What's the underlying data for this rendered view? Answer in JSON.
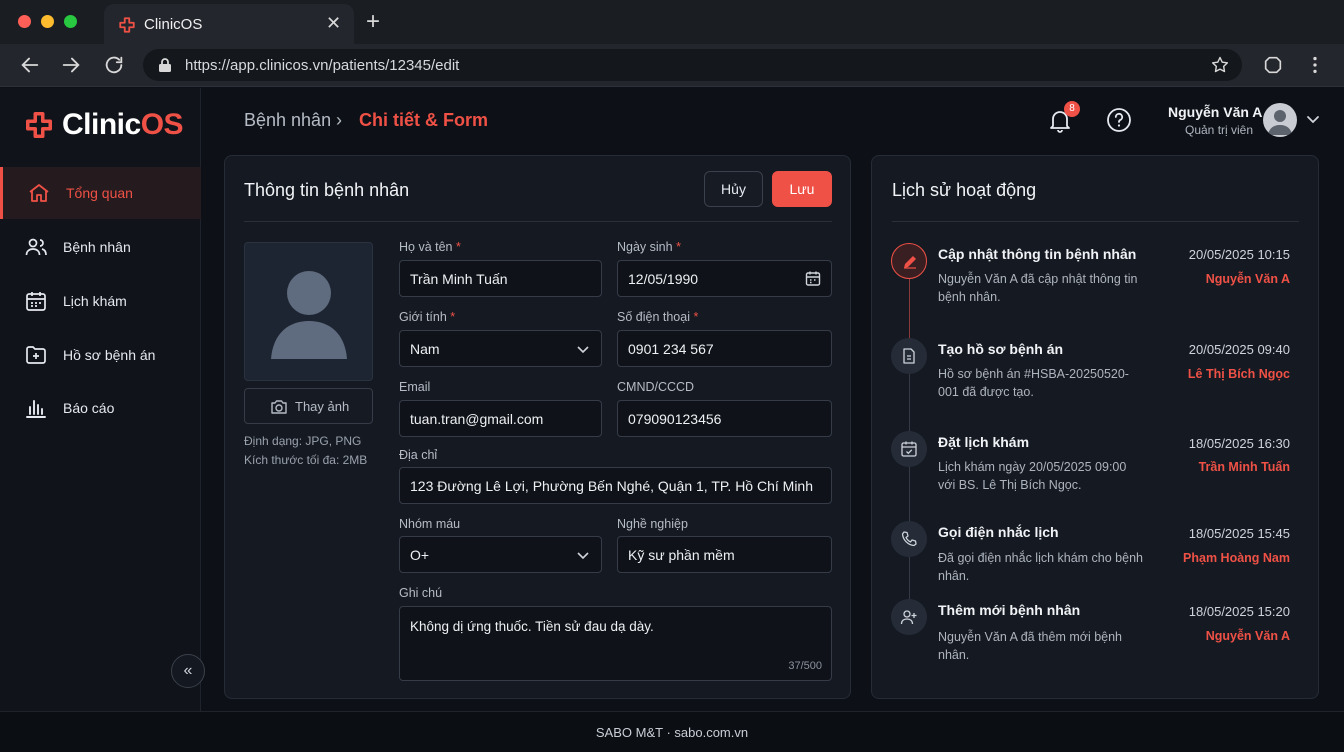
{
  "browser": {
    "tab_title": "ClinicOS",
    "url": "https://app.clinicos.vn/patients/12345/edit"
  },
  "brand": {
    "name_part1": "Clinic",
    "name_part2": "OS",
    "accent": "#ef5146"
  },
  "sidebar": {
    "items": [
      {
        "label": "Tổng quan",
        "icon": "home-icon",
        "active": true
      },
      {
        "label": "Bệnh nhân",
        "icon": "users-icon"
      },
      {
        "label": "Lịch khám",
        "icon": "calendar-icon"
      },
      {
        "label": "Hồ sơ bệnh án",
        "icon": "medical-folder-icon"
      },
      {
        "label": "Báo cáo",
        "icon": "bar-chart-icon"
      }
    ]
  },
  "header": {
    "breadcrumb_root": "Bệnh nhân",
    "breadcrumb_sep": "›",
    "breadcrumb_current": "Chi tiết & Form",
    "notification_count": "8",
    "user_name": "Nguyễn Văn A",
    "user_role": "Quản trị viên"
  },
  "patient_form": {
    "title": "Thông tin bệnh nhân",
    "cancel_label": "Hủy",
    "save_label": "Lưu",
    "change_photo_label": "Thay ảnh",
    "format_hint": "Định dạng: JPG, PNG",
    "size_hint": "Kích thước tối đa: 2MB",
    "fields": {
      "full_name": {
        "label": "Họ và tên",
        "required": "*",
        "value": "Trần Minh Tuấn"
      },
      "dob": {
        "label": "Ngày sinh",
        "required": "*",
        "value": "12/05/1990"
      },
      "gender": {
        "label": "Giới tính",
        "required": "*",
        "value": "Nam"
      },
      "phone": {
        "label": "Số điện thoại",
        "required": "*",
        "value": "0901 234 567"
      },
      "email": {
        "label": "Email",
        "value": "tuan.tran@gmail.com"
      },
      "id_card": {
        "label": "CMND/CCCD",
        "value": "079090123456"
      },
      "address": {
        "label": "Địa chỉ",
        "value": "123 Đường Lê Lợi, Phường Bến Nghé, Quận 1, TP. Hồ Chí Minh"
      },
      "blood_type": {
        "label": "Nhóm máu",
        "value": "O+"
      },
      "occupation": {
        "label": "Nghề nghiệp",
        "value": "Kỹ sư phần mềm"
      },
      "notes": {
        "label": "Ghi chú",
        "value": "Không dị ứng thuốc. Tiền sử đau dạ dày.",
        "counter": "37/500"
      }
    }
  },
  "activity": {
    "title": "Lịch sử hoạt động",
    "items": [
      {
        "title": "Cập nhật thông tin bệnh nhân",
        "desc": "Nguyễn Văn A đã cập nhật thông tin bệnh nhân.",
        "time": "20/05/2025 10:15",
        "user": "Nguyễn Văn A",
        "icon": "pencil-icon"
      },
      {
        "title": "Tạo hồ sơ bệnh án",
        "desc": "Hồ sơ bệnh án #HSBA-20250520-001 đã được tạo.",
        "time": "20/05/2025 09:40",
        "user": "Lê Thị Bích Ngọc",
        "icon": "document-icon"
      },
      {
        "title": "Đặt lịch khám",
        "desc": "Lịch khám ngày 20/05/2025 09:00 với BS. Lê Thị Bích Ngọc.",
        "time": "18/05/2025 16:30",
        "user": "Trần Minh Tuấn",
        "icon": "calendar-check-icon"
      },
      {
        "title": "Gọi điện nhắc lịch",
        "desc": "Đã gọi điện nhắc lịch khám cho bệnh nhân.",
        "time": "18/05/2025 15:45",
        "user": "Phạm Hoàng Nam",
        "icon": "phone-icon"
      },
      {
        "title": "Thêm mới bệnh nhân",
        "desc": "Nguyễn Văn A đã thêm mới bệnh nhân.",
        "time": "18/05/2025 15:20",
        "user": "Nguyễn Văn A",
        "icon": "user-plus-icon"
      }
    ]
  },
  "footer": {
    "text": "SABO M&T · sabo.com.vn"
  }
}
